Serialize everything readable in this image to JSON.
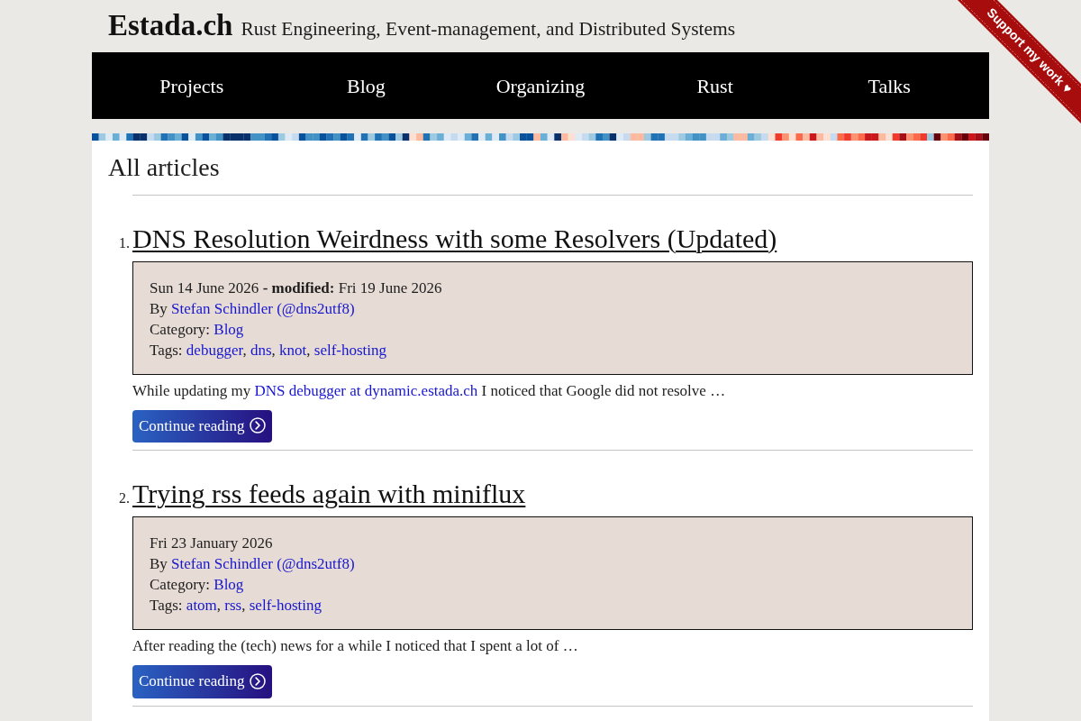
{
  "site": {
    "title": "Estada.ch",
    "tagline": "Rust Engineering, Event-management, and Distributed Systems"
  },
  "ribbon": {
    "label": "Support my work ♥"
  },
  "nav": [
    {
      "label": "Projects"
    },
    {
      "label": "Blog"
    },
    {
      "label": "Organizing"
    },
    {
      "label": "Rust"
    },
    {
      "label": "Talks"
    }
  ],
  "heading": "All articles",
  "articles": [
    {
      "number": "1.",
      "title": "DNS Resolution Weirdness with some Resolvers (Updated)",
      "date": "Sun 14 June 2026",
      "modified": {
        "label": "- modified:",
        "date": "Fri 19 June 2026"
      },
      "author_prefix": "By",
      "author": "Stefan Schindler (@dns2utf8)",
      "category_label": "Category:",
      "category": "Blog",
      "tags_label": "Tags:",
      "tags": [
        "debugger",
        "dns",
        "knot",
        "self-hosting"
      ],
      "tag_separator": ",",
      "summary": [
        {
          "kind": "text",
          "text": "While updating my"
        },
        {
          "kind": "link",
          "text": "DNS debugger at dynamic.estada.ch"
        },
        {
          "kind": "text",
          "text": "I noticed that Google did not resolve …"
        }
      ],
      "button": "Continue reading"
    },
    {
      "number": "2.",
      "title": "Trying rss feeds again with miniflux",
      "date": "Fri 23 January 2026",
      "author_prefix": "By",
      "author": "Stefan Schindler (@dns2utf8)",
      "category_label": "Category:",
      "category": "Blog",
      "tags_label": "Tags:",
      "tags": [
        "atom",
        "rss",
        "self-hosting"
      ],
      "tag_separator": ",",
      "summary": [
        {
          "kind": "text",
          "text": "After reading the (tech) news for a while I noticed that I spent a lot of …"
        }
      ],
      "button": "Continue reading"
    }
  ]
}
